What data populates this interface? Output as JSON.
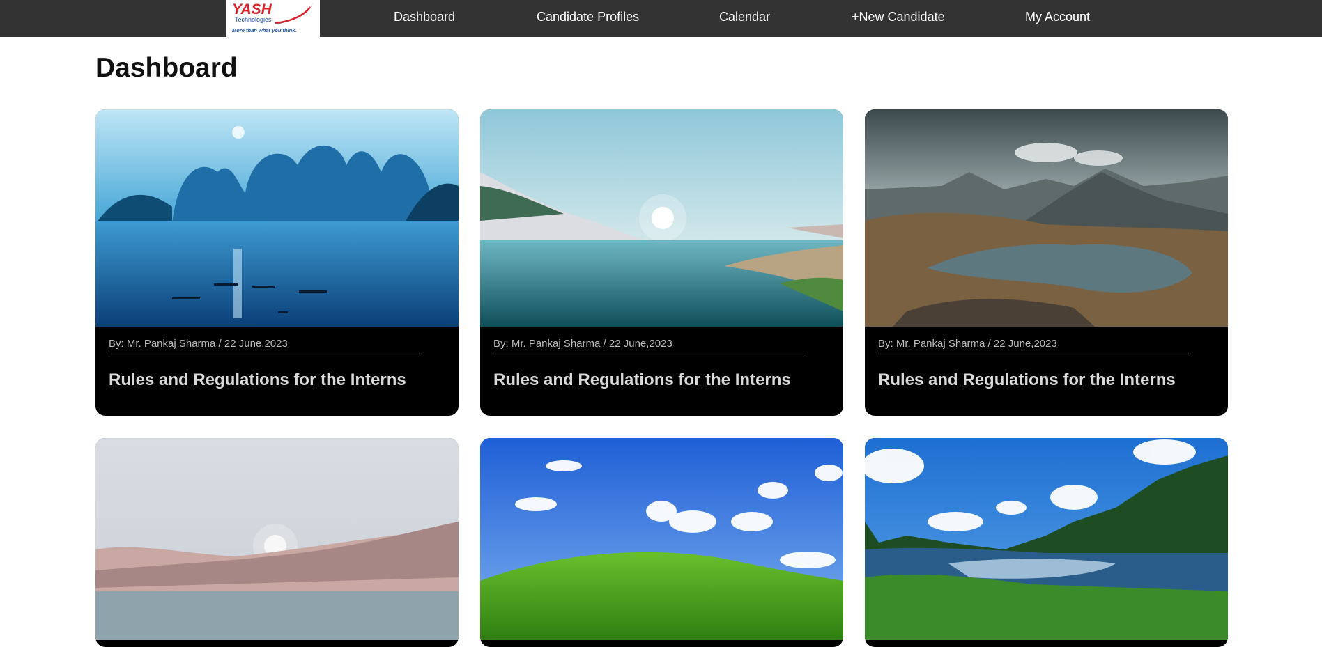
{
  "header": {
    "logo": {
      "text": "YASH",
      "subtext": "Technologies",
      "tagline": "More than what you think."
    },
    "nav": [
      {
        "label": "Dashboard"
      },
      {
        "label": "Candidate Profiles"
      },
      {
        "label": "Calendar"
      },
      {
        "label": "+New Candidate"
      },
      {
        "label": "My Account"
      }
    ]
  },
  "page": {
    "title": "Dashboard"
  },
  "cards": [
    {
      "meta": "By: Mr. Pankaj Sharma / 22 June,2023",
      "title": "Rules and Regulations for the Interns",
      "image": "blue-karst-river-image"
    },
    {
      "meta": "By: Mr. Pankaj Sharma / 22 June,2023",
      "title": "Rules and Regulations for the Interns",
      "image": "calm-lake-sunrise-image"
    },
    {
      "meta": "By: Mr. Pankaj Sharma / 22 June,2023",
      "title": "Rules and Regulations for the Interns",
      "image": "mountain-tarn-image"
    },
    {
      "image": "pastel-desert-dunes-image"
    },
    {
      "image": "green-hill-blue-sky-image"
    },
    {
      "image": "forest-lake-image"
    }
  ],
  "colors": {
    "topbar": "#333333",
    "card_bg": "#000000",
    "brand_red": "#d9232a",
    "brand_blue": "#1c4fa0"
  }
}
